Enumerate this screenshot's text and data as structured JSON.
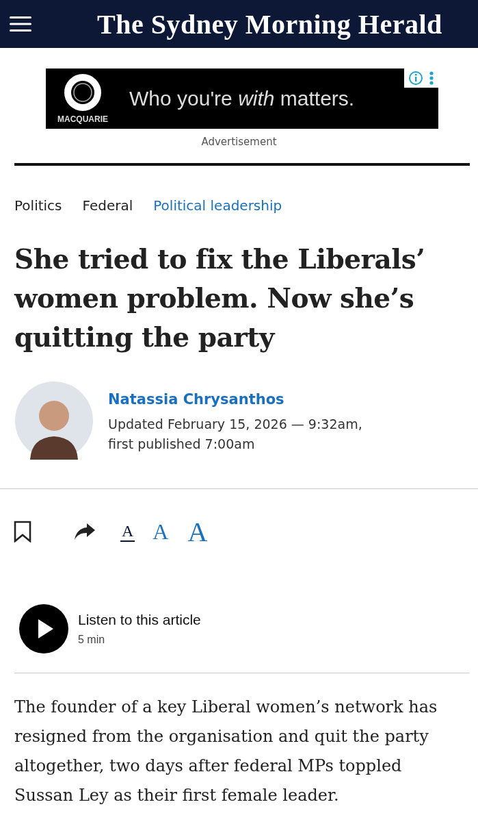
{
  "masthead": {
    "title": "The Sydney Morning Herald"
  },
  "ad": {
    "brand": "MACQUARIE",
    "slogan": "Who you're *with* matters.",
    "caption": "Advertisement"
  },
  "breadcrumbs": [
    {
      "label": "Politics",
      "selected": false
    },
    {
      "label": "Federal",
      "selected": false
    },
    {
      "label": "Political leadership",
      "selected": true
    }
  ],
  "headline": "She tried to fix the Liberals’ women problem. Now she’s quitting the party",
  "byline": {
    "author": "Natassia Chrysanthos",
    "updated": "Updated February 15, 2026 — 9:32am,",
    "published": "first published 7:00am"
  },
  "text_sizes": [
    {
      "label": "A",
      "selected": true
    },
    {
      "label": "A",
      "selected": false
    },
    {
      "label": "A",
      "selected": false
    }
  ],
  "audio": {
    "label": "Listen to this article",
    "duration": "5 min"
  },
  "body": "The founder of a key Liberal women’s network has resigned from the organisation and quit the party altogether, two days after federal MPs toppled Sussan Ley as their first female leader."
}
